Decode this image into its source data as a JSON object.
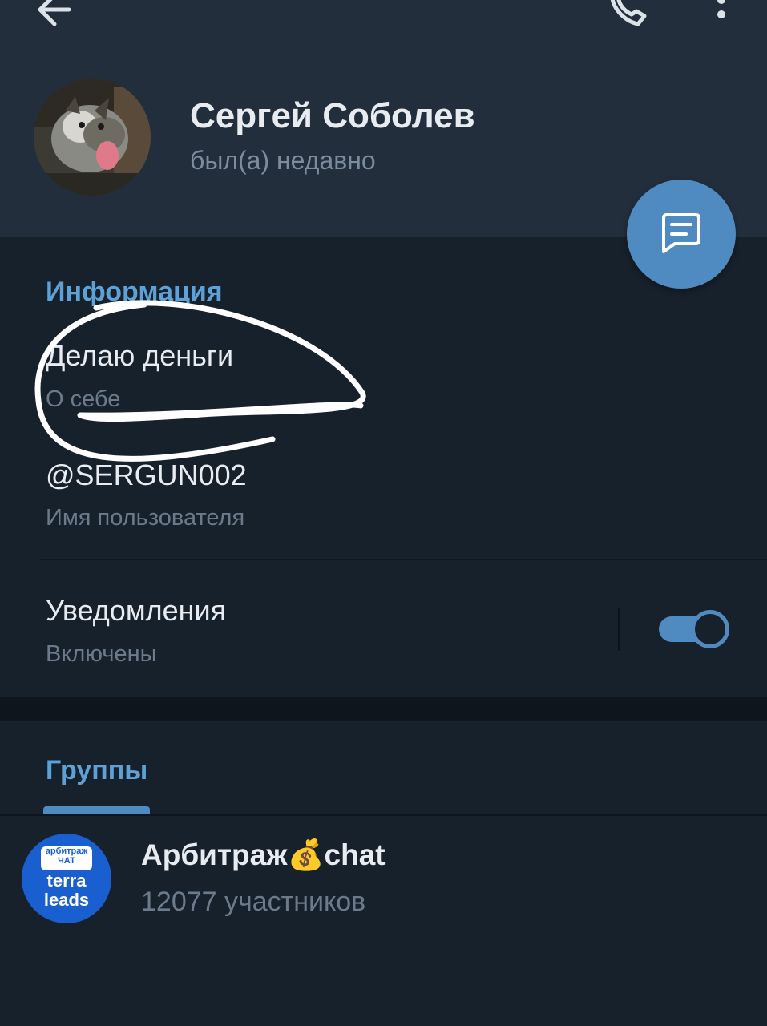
{
  "header": {
    "name": "Сергей Соболев",
    "status": "был(а) недавно"
  },
  "icons": {
    "back": "arrow-left-icon",
    "call": "phone-icon",
    "more": "more-vertical-icon",
    "message": "message-icon"
  },
  "info": {
    "title": "Информация",
    "bio": "Делаю деньги",
    "bio_label": "О себе",
    "username": "@SERGUN002",
    "username_label": "Имя пользователя",
    "notifications": "Уведомления",
    "notifications_state": "Включены",
    "notifications_on": true
  },
  "groups": {
    "title": "Группы",
    "items": [
      {
        "name": "Арбитраж💰chat",
        "members": "12077 участников",
        "avatar_text_top_1": "арбитраж",
        "avatar_text_top_2": "ЧАТ",
        "avatar_text_1": "terra",
        "avatar_text_2": "leads"
      }
    ]
  },
  "colors": {
    "accent": "#5ea1d6",
    "header_bg": "#232e3c",
    "page_bg": "#17212b"
  }
}
